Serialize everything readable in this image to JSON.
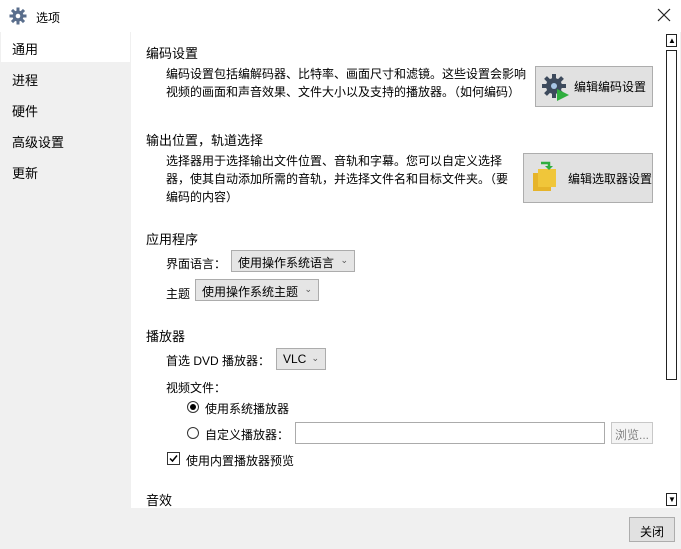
{
  "window": {
    "title": "选项",
    "icon": "gear-icon"
  },
  "sidebar": {
    "items": [
      {
        "label": "通用",
        "active": true
      },
      {
        "label": "进程"
      },
      {
        "label": "硬件"
      },
      {
        "label": "高级设置"
      },
      {
        "label": "更新"
      }
    ]
  },
  "encoding": {
    "title": "编码设置",
    "desc": "编码设置包括编解码器、比特率、画面尺寸和滤镜。这些设置会影响视频的画面和声音效果、文件大小以及支持的播放器。（如何编码）",
    "button_label": "编辑编码设置"
  },
  "output": {
    "title": "输出位置，轨道选择",
    "desc": "选择器用于选择输出文件位置、音轨和字幕。您可以自定义选择器，使其自动添加所需的音轨，并选择文件名和目标文件夹。（要编码的内容）",
    "button_label": "编辑选取器设置"
  },
  "application": {
    "title": "应用程序",
    "language_label": "界面语言：",
    "language_value": "使用操作系统语言",
    "theme_label": "主题",
    "theme_value": "使用操作系统主题"
  },
  "player": {
    "title": "播放器",
    "dvd_label": "首选 DVD 播放器：",
    "dvd_value": "VLC",
    "video_files_label": "视频文件：",
    "radio_system": "使用系统播放器",
    "radio_custom": "自定义播放器：",
    "custom_path": "",
    "browse_label": "浏览...",
    "builtin_preview": "使用内置播放器预览"
  },
  "audio": {
    "title": "音效"
  },
  "footer": {
    "close_label": "关闭"
  }
}
